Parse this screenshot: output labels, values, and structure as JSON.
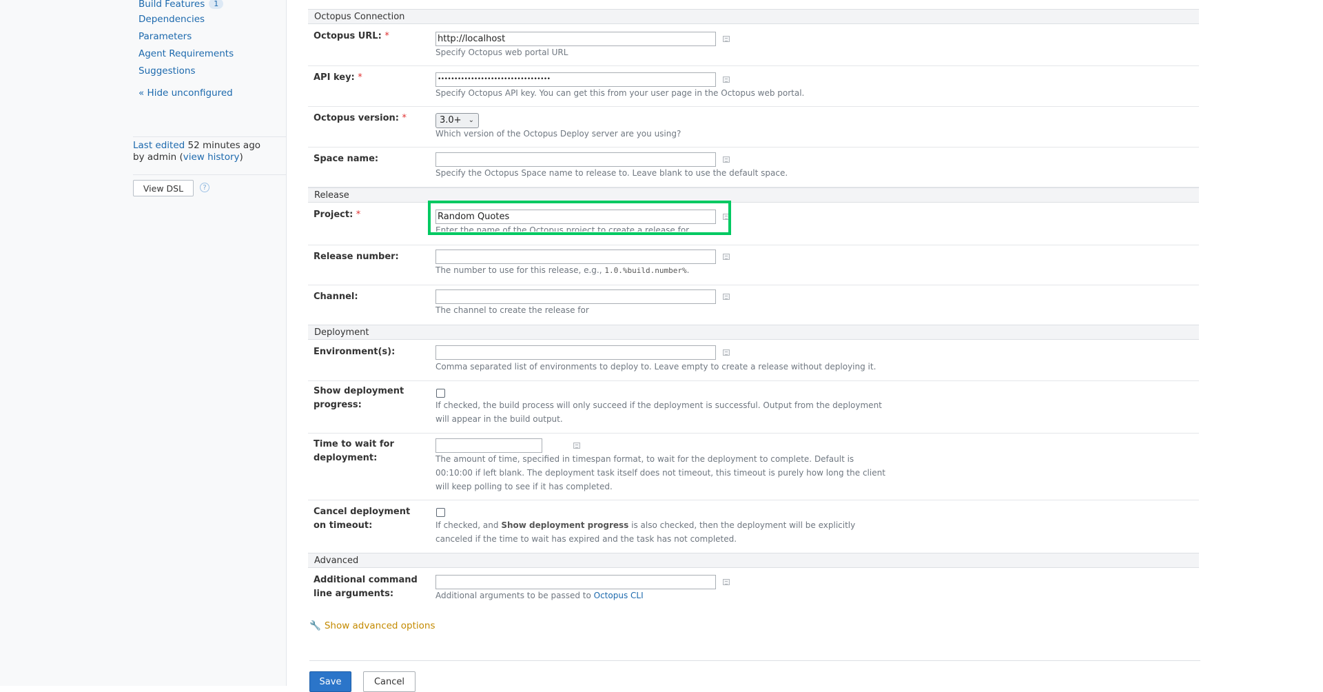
{
  "sidebar": {
    "items": [
      {
        "label": "Build Features",
        "badge": "1"
      },
      {
        "label": "Dependencies"
      },
      {
        "label": "Parameters"
      },
      {
        "label": "Agent Requirements"
      },
      {
        "label": "Suggestions"
      }
    ],
    "hide_unconfigured": "« Hide unconfigured",
    "last_edited_link": "Last edited",
    "last_edited_time": " 52 minutes ago",
    "by_text": "by admin  (",
    "view_history": "view history",
    "close_paren": ")",
    "view_dsl": "View DSL",
    "help_glyph": "?"
  },
  "sections": {
    "octopus_connection": "Octopus Connection",
    "release": "Release",
    "deployment": "Deployment",
    "advanced": "Advanced"
  },
  "fields": {
    "octopus_url": {
      "label": "Octopus URL:",
      "value": "http://localhost",
      "desc": "Specify Octopus web portal URL"
    },
    "api_key": {
      "label": "API key:",
      "value": "••••••••••••••••••••••••••••••••••",
      "desc": "Specify Octopus API key. You can get this from your user page in the Octopus web portal."
    },
    "octopus_version": {
      "label": "Octopus version:",
      "value": "3.0+",
      "desc": "Which version of the Octopus Deploy server are you using?"
    },
    "space_name": {
      "label": "Space name:",
      "value": "",
      "desc": "Specify the Octopus Space name to release to. Leave blank to use the default space."
    },
    "project": {
      "label": "Project:",
      "value": "Random Quotes",
      "desc": "Enter the name of the Octopus project to create a release for"
    },
    "release_number": {
      "label": "Release number:",
      "value": "",
      "desc_prefix": "The number to use for this release, e.g., ",
      "desc_code": "1.0.%build.number%",
      "desc_suffix": "."
    },
    "channel": {
      "label": "Channel:",
      "value": "",
      "desc": "The channel to create the release for"
    },
    "environments": {
      "label": "Environment(s):",
      "value": "",
      "desc": "Comma separated list of environments to deploy to. Leave empty to create a release without deploying it."
    },
    "show_deployment_progress": {
      "label_line1": "Show deployment",
      "label_line2": "progress:",
      "checked": false,
      "desc_line1": "If checked, the build process will only succeed if the deployment is successful. Output from the deployment",
      "desc_line2": "will appear in the build output."
    },
    "time_to_wait": {
      "label_line1": "Time to wait for",
      "label_line2": "deployment:",
      "value": "",
      "desc_line1": "The amount of time, specified in timespan format, to wait for the deployment to complete. Default is",
      "desc_line2": "00:10:00 if left blank. The deployment task itself does not timeout, this timeout is purely how long the client",
      "desc_line3": "will keep polling to see if it has completed."
    },
    "cancel_on_timeout": {
      "label_line1": "Cancel deployment",
      "label_line2": "on timeout:",
      "checked": false,
      "desc_pre": "If checked, and ",
      "desc_bold": "Show deployment progress",
      "desc_post": " is also checked, then the deployment will be explicitly",
      "desc_line2": "canceled if the time to wait has expired and the task has not completed."
    },
    "additional_args": {
      "label_line1": "Additional command",
      "label_line2": "line arguments:",
      "value": "",
      "desc_prefix": "Additional arguments to be passed to ",
      "desc_link": "Octopus CLI"
    }
  },
  "required_mark": "*",
  "show_advanced_options": "Show advanced options",
  "buttons": {
    "save": "Save",
    "cancel": "Cancel"
  },
  "colors": {
    "highlight": "#00c962",
    "link": "#1c69ad",
    "primary_button": "#2b75c9",
    "advanced_link": "#c48a00"
  }
}
